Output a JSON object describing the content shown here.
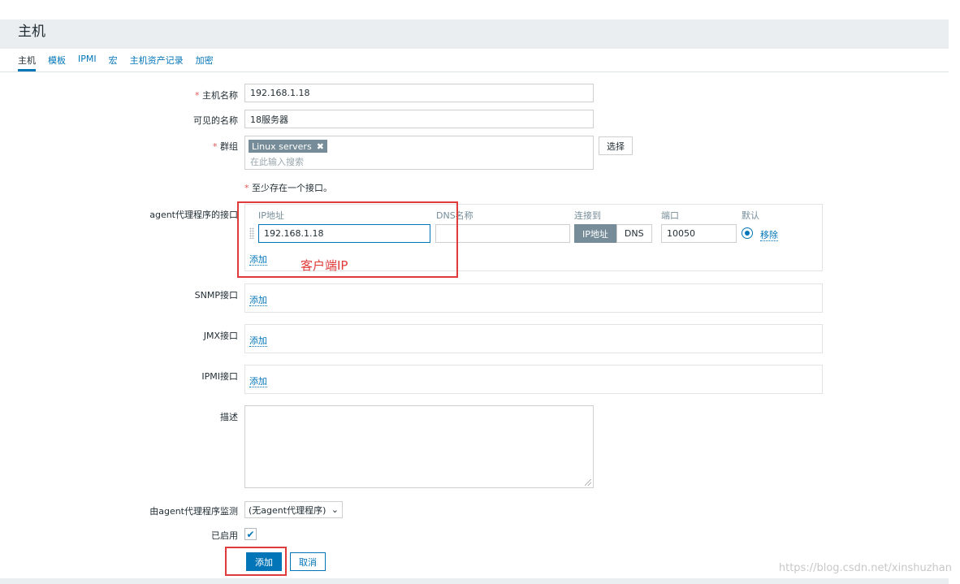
{
  "header": {
    "title": "主机"
  },
  "tabs": [
    {
      "label": "主机",
      "active": true
    },
    {
      "label": "模板"
    },
    {
      "label": "IPMI"
    },
    {
      "label": "宏"
    },
    {
      "label": "主机资产记录"
    },
    {
      "label": "加密"
    }
  ],
  "form": {
    "required_mark": "*",
    "hostname_label": "主机名称",
    "hostname_value": "192.168.1.18",
    "visible_name_label": "可见的名称",
    "visible_name_value": "18服务器",
    "groups_label": "群组",
    "group_tag": "Linux servers",
    "group_tag_remove": "✖",
    "groups_placeholder": "在此输入搜索",
    "select_button": "选择",
    "interface_note": "至少存在一个接口。",
    "agent_label": "agent代理程序的接口",
    "agent": {
      "col_ip": "IP地址",
      "col_dns": "DNS名称",
      "col_connect": "连接到",
      "col_port": "端口",
      "col_default": "默认",
      "ip_value": "192.168.1.18",
      "dns_value": "",
      "connect_options": [
        "IP地址",
        "DNS"
      ],
      "connect_selected": "IP地址",
      "port_value": "10050",
      "remove_link": "移除",
      "add_link": "添加"
    },
    "annotation": "客户端IP",
    "snmp_label": "SNMP接口",
    "jmx_label": "JMX接口",
    "ipmi_label": "IPMI接口",
    "add_link": "添加",
    "description_label": "描述",
    "description_value": "",
    "proxy_label": "由agent代理程序监测",
    "proxy_value": "(无agent代理程序)",
    "enabled_label": "已启用",
    "enabled": true,
    "add_button": "添加",
    "cancel_button": "取消"
  },
  "watermark": "https://blog.csdn.net/xinshuzhan",
  "colors": {
    "accent": "#0275b8",
    "annotation": "#e03a3a",
    "tag": "#768d99"
  }
}
